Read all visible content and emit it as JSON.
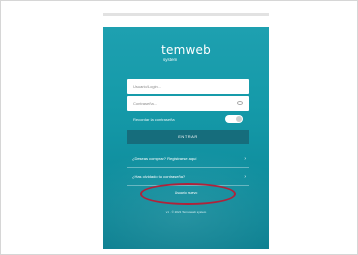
{
  "app": {
    "brand_main": "temweb",
    "brand_sub": "system"
  },
  "login": {
    "username_placeholder": "Usuario/Login...",
    "password_placeholder": "Contraseña...",
    "remember_label": "Recordar la contraseña",
    "submit_label": "ENTRAR"
  },
  "links": [
    {
      "label": "¿Deseas comprar? Registrarse aquí"
    },
    {
      "label": "¿Has olvidado tu contraseña?"
    }
  ],
  "new_user_label": "Usuario nuevo",
  "footer": "v1 · © 2021 Termoweb system",
  "colors": {
    "primary": "#169aa9",
    "button": "#166d7c",
    "highlight": "#b0223a"
  }
}
